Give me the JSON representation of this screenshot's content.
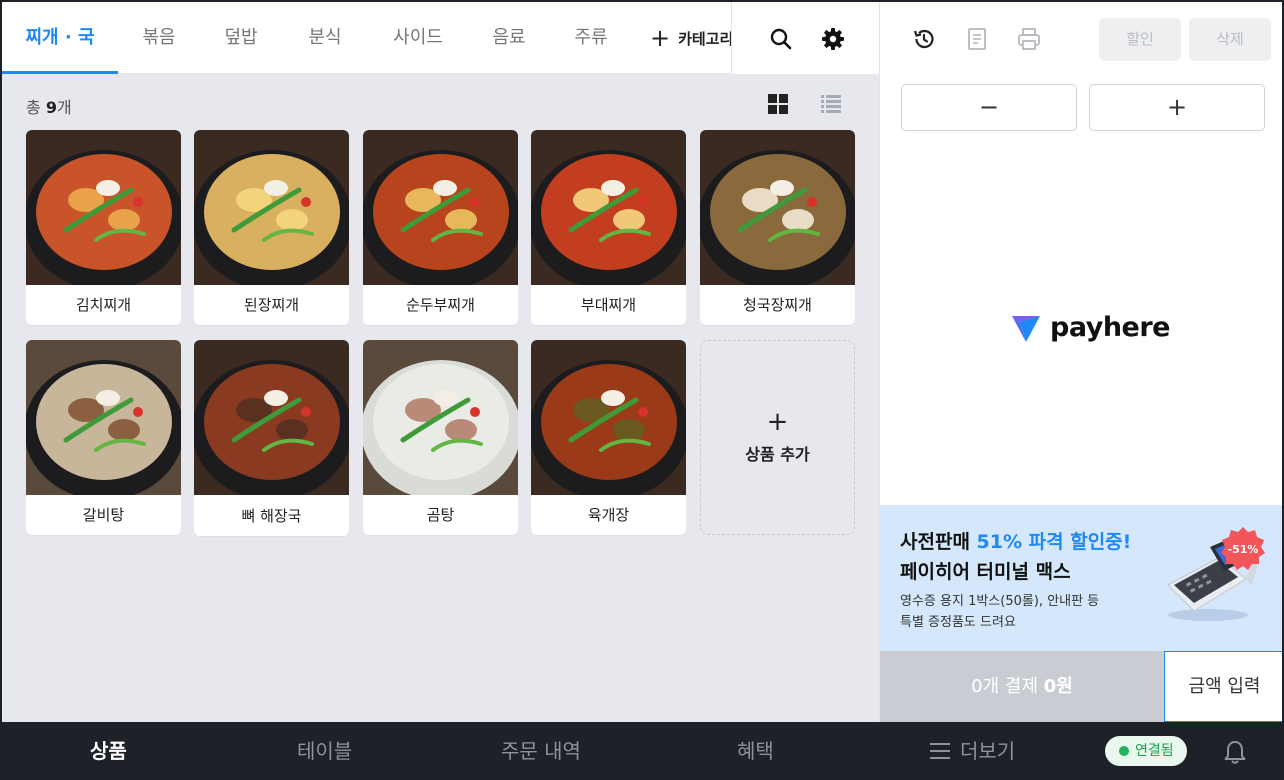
{
  "tabs": [
    "찌개 · 국",
    "볶음",
    "덮밥",
    "분식",
    "사이드",
    "음료",
    "주류"
  ],
  "add_category_label": "카테고리 추가",
  "count": {
    "prefix": "총 ",
    "number": "9",
    "suffix": "개"
  },
  "products": [
    {
      "name": "김치찌개",
      "soup": "#c9542a",
      "accent": "#e8a24a"
    },
    {
      "name": "된장찌개",
      "soup": "#d8b060",
      "accent": "#f2d27a"
    },
    {
      "name": "순두부찌개",
      "soup": "#b8441e",
      "accent": "#e6b85a"
    },
    {
      "name": "부대찌개",
      "soup": "#c23e1e",
      "accent": "#f0c878"
    },
    {
      "name": "청국장찌개",
      "soup": "#8a6a3c",
      "accent": "#e8dcc4"
    },
    {
      "name": "갈비탕",
      "soup": "#c8b69a",
      "accent": "#8a6040"
    },
    {
      "name": "뼈 해장국",
      "soup": "#8a3a20",
      "accent": "#5a3020"
    },
    {
      "name": "곰탕",
      "soup": "#e8ece4",
      "accent": "#b98a78"
    },
    {
      "name": "육개장",
      "soup": "#9a3a18",
      "accent": "#6a5a20"
    }
  ],
  "add_product": {
    "plus": "+",
    "label": "상품 추가"
  },
  "right": {
    "discount_label": "할인",
    "delete_label": "삭제",
    "minus_label": "−",
    "plus_label": "+",
    "logo_text": "payhere"
  },
  "banner": {
    "line1_prefix": "사전판매 ",
    "line1_highlight": "51% 파격 할인중!",
    "line2": "페이히어 터미널 맥스",
    "line3": "영수증 용지 1박스(50롤), 안내판 등",
    "line4": "특별 증정품도 드려요",
    "badge": "-51%"
  },
  "payment": {
    "count": "0개",
    "word": " 결제 ",
    "amount": "0원",
    "amount_input_label": "금액 입력"
  },
  "bottom_nav": [
    "상품",
    "테이블",
    "주문 내역",
    "혜택",
    "더보기"
  ],
  "status": "연결됨",
  "colors": {
    "accent": "#1e88f5",
    "nav_bg": "#1e2128",
    "banner_bg": "#d5e8fb",
    "status_green": "#22b35b"
  }
}
